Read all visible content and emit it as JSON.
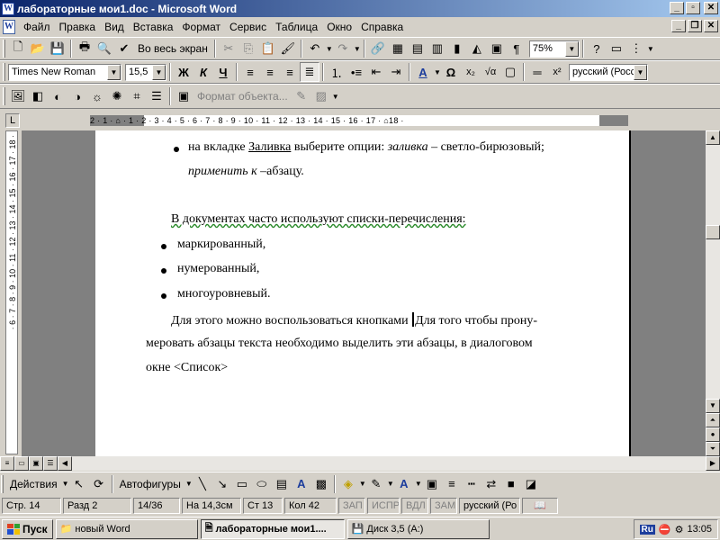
{
  "window": {
    "title": "лабораторные мои1.doc - Microsoft Word",
    "icon": "word-icon"
  },
  "menu": [
    "Файл",
    "Правка",
    "Вид",
    "Вставка",
    "Формат",
    "Сервис",
    "Таблица",
    "Окно",
    "Справка"
  ],
  "standard_toolbar": {
    "fullscreen_label": "Во весь экран",
    "zoom": "75%"
  },
  "formatting_toolbar": {
    "font": "Times New Roman",
    "size": "15,5",
    "language": "русский (Росс"
  },
  "picture_toolbar": {
    "format_object_label": "Формат объекта..."
  },
  "ruler": {
    "text": "2 · 1 · ⌂ · 1 · 2 · 3 · 4 · 5 · 6 · 7 · 8 · 9 · 10 · 11 · 12 · 13 · 14 · 15 · 16 · 17 · ⌂18 ·"
  },
  "vruler": {
    "text": "· 6 · 7 · 8 · 9 · 10 · 11 · 12 · 13 · 14 · 15 · 16 · 17 · 18 ·"
  },
  "document": {
    "l1_a": "на вкладке ",
    "l1_link": "Заливка",
    "l1_b": " выберите опции: ",
    "l1_italic": "заливка",
    "l1_c": " – светло-бирюзовый;",
    "l2_italic": "применить к",
    "l2_rest": " –абзацу.",
    "l3": "В документах часто используют списки-перечисления:",
    "list": [
      "маркированный,",
      "нумерованный,",
      "многоуровневый."
    ],
    "p_a": "Для  этого  можно  воспользоваться  кнопками ",
    "p_b": "Для  того  чтобы  прону-",
    "p_line2": "меровать  абзацы  текста  необходимо  выделить  эти  абзацы,  в  диалоговом",
    "p_line3": "окне <Список>"
  },
  "drawing_toolbar": {
    "actions": "Действия",
    "autoshapes": "Автофигуры"
  },
  "status": {
    "page": "Стр.  14",
    "section": "Разд  2",
    "pages": "14/36",
    "at": "На 14,3см",
    "line": "Ст  13",
    "col": "Кол  42",
    "rec": "ЗАП",
    "trk": "ИСПР",
    "ext": "ВДЛ",
    "ovr": "ЗАМ",
    "lang": "русский (Ро"
  },
  "taskbar": {
    "start": "Пуск",
    "tasks": [
      "новый Word",
      "лабораторные мои1....",
      "Диск 3,5 (A:)"
    ],
    "lang": "Ru",
    "time": "13:05"
  },
  "colors": {
    "title_start": "#0a246a",
    "title_end": "#a6caf0",
    "face": "#d4d0c8"
  }
}
